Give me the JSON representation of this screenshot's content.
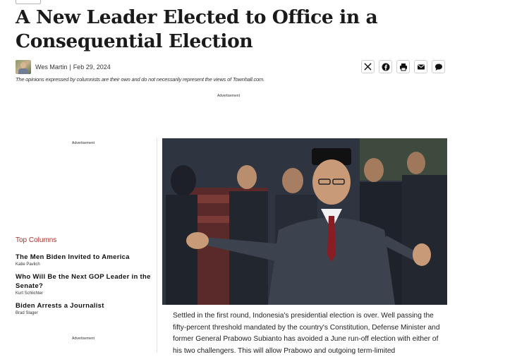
{
  "article": {
    "title": "A New Leader Elected to Office in a Consequential Election",
    "author": "Wes Martin",
    "date": "Feb 29, 2024",
    "disclaimer": "The opinions expressed by columnists are their own and do not necessarily represent the views of Townhall.com.",
    "body": "Settled in the first round, Indonesia's presidential election is over. Well passing the fifty-percent threshold mandated by the country's Constitution, Defense Minister and former General Prabowo Subianto has avoided a June run-off election with either of his two challengers. This will allow Prabowo and outgoing term-limited"
  },
  "ads": {
    "label": "Advertisement"
  },
  "share": {
    "icons": [
      "x-icon",
      "facebook-icon",
      "print-icon",
      "email-icon",
      "comment-icon"
    ]
  },
  "sidebar": {
    "heading": "Top Columns",
    "columns": [
      {
        "title": "The Men Biden Invited to America",
        "author": "Katie Pavlich"
      },
      {
        "title": "Who Will Be the Next GOP Leader in the Senate?",
        "author": "Kurt Schlichter"
      },
      {
        "title": "Biden Arrests a Journalist",
        "author": "Brad Slager"
      }
    ]
  },
  "colors": {
    "accent": "#a8322a",
    "text": "#1a1a1a",
    "border": "#cfcfcf"
  }
}
